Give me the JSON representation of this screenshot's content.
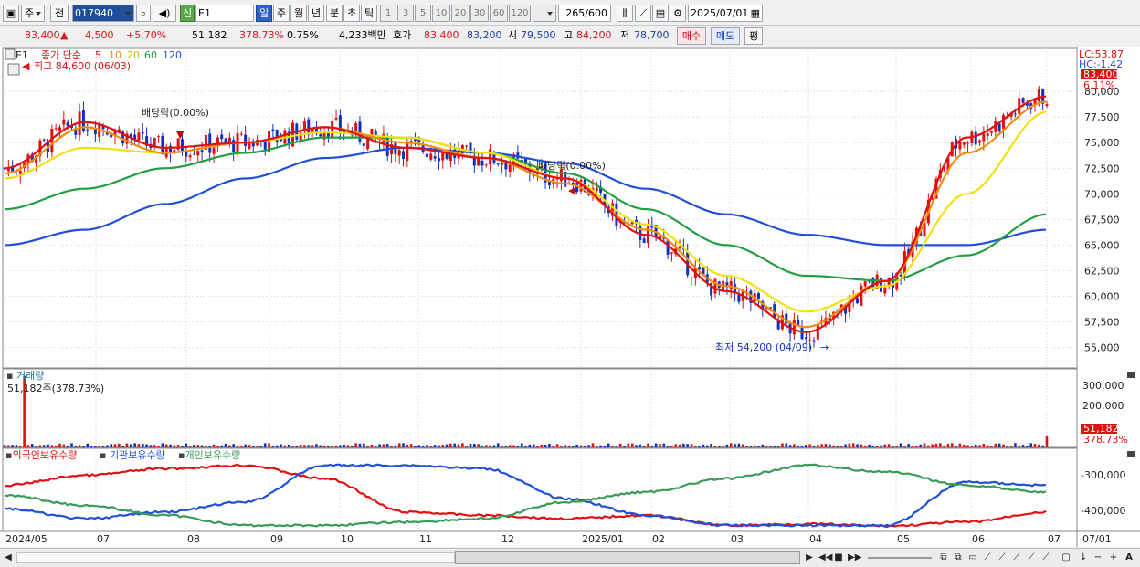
{
  "toolbar": {
    "period_label": "주",
    "prev_label": "전",
    "code_value": "017940",
    "indicator_value": "E1",
    "new_label": "신",
    "timeframes": [
      "일",
      "주",
      "월",
      "년",
      "분",
      "초",
      "틱"
    ],
    "minutes": [
      "1",
      "3",
      "5",
      "10",
      "20",
      "30",
      "60",
      "120"
    ],
    "count_value": "265",
    "count_total": "/600",
    "date_value": "2025/07/01"
  },
  "quote": {
    "price": "83,400",
    "change_arrow": "▲",
    "change": "4,500",
    "change_pct": "+5.70%",
    "volume": "51,182",
    "volume_ratio": "378.73%",
    "turnover_rate": "0.75%",
    "amount": "4,233백만",
    "quote_label": "호가",
    "ask": "83,400",
    "bid": "83,200",
    "open_label": "시",
    "open": "79,500",
    "high_label": "고",
    "high": "84,200",
    "low_label": "저",
    "low": "78,700",
    "buy_label": "매수",
    "sell_label": "매도",
    "avg_label": "평"
  },
  "price_pane": {
    "tab_label": "E1",
    "legend": {
      "title": "종가 단순",
      "periods": [
        "5",
        "10",
        "20",
        "60",
        "120"
      ]
    },
    "high_marker": "최고 84,600 (06/03)",
    "low_marker": "최저 54,200 (04/09)",
    "dividend_labels": [
      "배당락(0.00%)",
      "배당락(0.00%)"
    ],
    "lc_label": "LC:53.87",
    "hc_label": "HC:-1.42",
    "last_price_tag": "83,400",
    "last_pct_tag": "6.11%",
    "y_ticks": [
      "80,000",
      "77,500",
      "75,000",
      "72,500",
      "70,000",
      "67,500",
      "65,000",
      "62,500",
      "60,000",
      "57,500",
      "55,000"
    ]
  },
  "volume_pane": {
    "title": "거래량",
    "readout": "51,182주(378.73%)",
    "y_ticks": [
      "300,000",
      "200,000"
    ],
    "last_tag": "51,182",
    "last_pct_tag": "378.73%"
  },
  "holdings_pane": {
    "legend": [
      "외국인보유수량",
      "기관보유수량",
      "개인보유수량"
    ],
    "y_ticks": [
      "-300,000",
      "-400,000"
    ]
  },
  "x_axis": {
    "ticks": [
      "2024/05",
      "07",
      "08",
      "09",
      "10",
      "11",
      "12",
      "2025/01",
      "02",
      "03",
      "04",
      "05",
      "06",
      "07"
    ],
    "right_label": "07/01"
  },
  "colors": {
    "up": "#e01010",
    "down": "#1030c0",
    "ma5": "#e01010",
    "ma10": "#f08c10",
    "ma20": "#f0e010",
    "ma60": "#20a040",
    "ma120": "#2050d8",
    "foreign": "#e01010",
    "institution": "#2050d8",
    "individual": "#3a9a5a"
  },
  "chart_data": {
    "type": "line",
    "x": [
      "2024/05",
      "07",
      "08",
      "09",
      "10",
      "11",
      "12",
      "2025/01",
      "02",
      "03",
      "04",
      "05",
      "06",
      "07"
    ],
    "price_ylim": [
      53000,
      84200
    ],
    "series": [
      {
        "name": "5",
        "values": [
          72500,
          77000,
          74500,
          75000,
          76500,
          74500,
          73500,
          71500,
          66000,
          60500,
          56500,
          61500,
          75500,
          79500
        ]
      },
      {
        "name": "10",
        "values": [
          72000,
          76500,
          74000,
          75000,
          76500,
          75000,
          73500,
          71000,
          66500,
          61000,
          57000,
          61500,
          74000,
          79000
        ]
      },
      {
        "name": "20",
        "values": [
          71500,
          74500,
          74000,
          75000,
          76000,
          75500,
          74000,
          71500,
          67000,
          62000,
          58500,
          61000,
          70000,
          78000
        ]
      },
      {
        "name": "60",
        "values": [
          68500,
          70500,
          72500,
          74000,
          75500,
          75500,
          74000,
          72000,
          68500,
          65000,
          62000,
          61500,
          64000,
          68000
        ]
      },
      {
        "name": "120",
        "values": [
          65000,
          66500,
          69000,
          71500,
          73500,
          74500,
          74000,
          73000,
          70500,
          68000,
          66000,
          65000,
          65000,
          66500
        ]
      }
    ],
    "volume_ylim": [
      0,
      350000
    ],
    "volume_last": 51182
  }
}
